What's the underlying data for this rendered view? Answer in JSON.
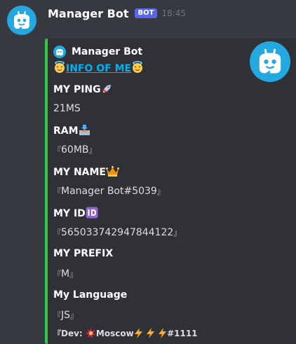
{
  "message": {
    "username": "Manager Bot",
    "bot_tag": "BOT",
    "timestamp": "18:45",
    "accent_color": "#2ecc40"
  },
  "embed": {
    "author": "Manager Bot",
    "title": "INFO OF ME",
    "title_emoji": "smiling-face-with-halo",
    "fields": [
      {
        "name": "MY PING",
        "value": "21MS",
        "emoji": "rocket",
        "bracketed": false
      },
      {
        "name": "RAM",
        "value": "60MB",
        "emoji": "inbox-tray",
        "bracketed": true
      },
      {
        "name": "MY NAME",
        "value": "Manager Bot#5039",
        "emoji": "crown",
        "bracketed": true
      },
      {
        "name": "MY ID",
        "value": "565033742947844122",
        "emoji": "id-button",
        "bracketed": true
      },
      {
        "name": "MY PREFIX",
        "value": "M",
        "emoji": "",
        "bracketed": true
      },
      {
        "name": "My Language",
        "value": "JS",
        "emoji": "",
        "bracketed": true
      }
    ],
    "footer": {
      "prefix": "Dev:",
      "name": "Moscow",
      "tag": "#1111",
      "emojis": [
        "collision",
        "high-voltage"
      ]
    }
  },
  "brackets": {
    "open": "『",
    "close": "』"
  }
}
